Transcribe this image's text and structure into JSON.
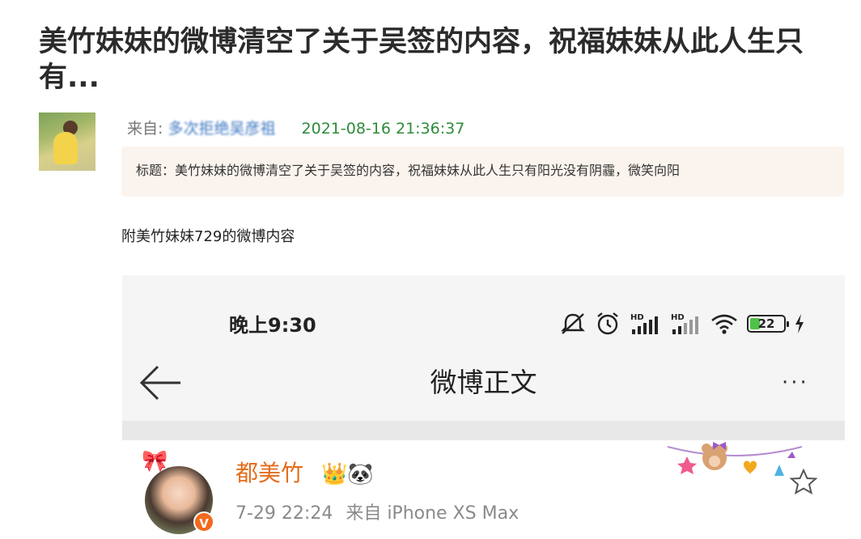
{
  "article": {
    "title": "美竹妹妹的微博清空了关于吴签的内容，祝福妹妹从此人生只有..."
  },
  "post_meta": {
    "from_label": "来自:",
    "from_name": "多次拒绝吴彦祖",
    "datetime": "2021-08-16 21:36:37"
  },
  "quote": {
    "text": "标题：美竹妹妹的微博清空了关于吴签的内容，祝福妹妹从此人生只有阳光没有阴霾，微笑向阳"
  },
  "body": {
    "text": "附美竹妹妹729的微博内容"
  },
  "phone": {
    "status_time": "晚上9:30",
    "battery_level": "22",
    "nav_title": "微博正文",
    "more_label": "···",
    "post": {
      "username": "都美竹",
      "verified_badge": "V",
      "time": "7-29 22:24",
      "source": "来自 iPhone XS Max",
      "name_icons": "👑🐼",
      "sticker_text": "🎀"
    }
  },
  "colors": {
    "username": "#e46d1d",
    "date": "#2e8b3a",
    "from_name": "#3c77c2",
    "quote_bg": "#fbf4ee"
  }
}
